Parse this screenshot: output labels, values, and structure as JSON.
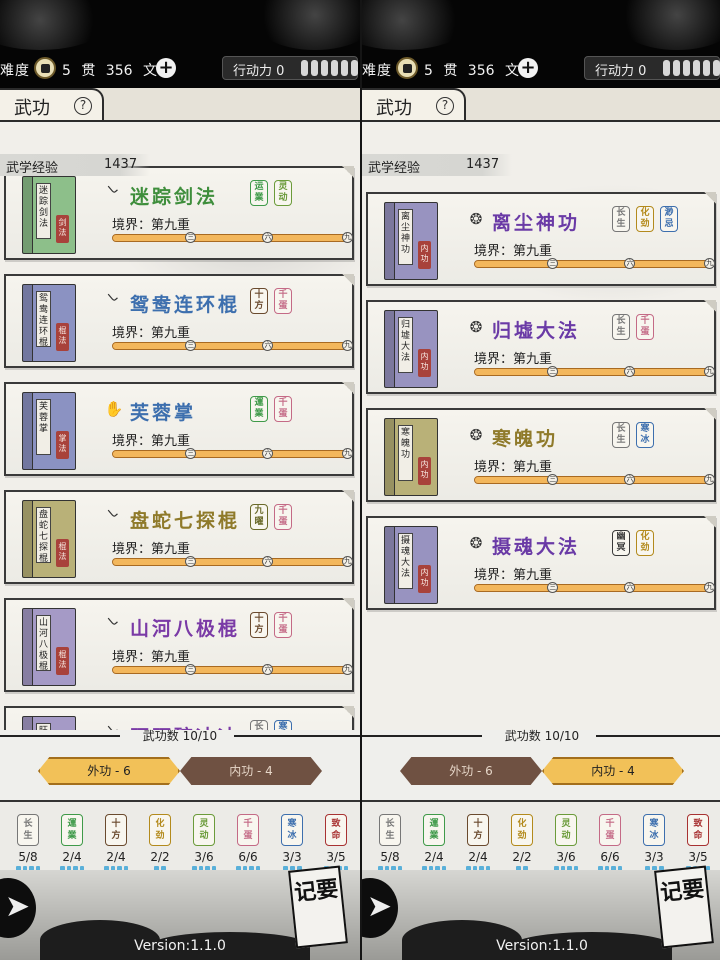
{
  "status": {
    "difficulty_label": "难度",
    "money": "5 贯 356 文",
    "action_label": "行动力",
    "action_value": "0"
  },
  "header": {
    "title": "武功",
    "help_symbol": "?"
  },
  "exp": {
    "label": "武学经验",
    "value": "1437"
  },
  "footer": {
    "count": "武功数 10/10",
    "tabs": {
      "outer": "外功 - 6",
      "inner": "内功 - 4"
    },
    "version": "Version:1.1.0",
    "memo": "记要"
  },
  "panels": {
    "left": {
      "active_tab": "outer",
      "skills": [
        {
          "name": "迷踪剑法",
          "book": "迷踪剑法",
          "seal": "剑法",
          "color": "#3f8e3c",
          "cover": "#8dbf8a",
          "icon": "sword-icon",
          "progress": 1.0,
          "badges": [
            {
              "t": "运\n業",
              "c": "#3f9a49"
            },
            {
              "t": "灵\n动",
              "c": "#6b9b3a"
            }
          ]
        },
        {
          "name": "鸳鸯连环棍",
          "book": "鸳鸯连环棍",
          "seal": "棍法",
          "color": "#3d6fae",
          "cover": "#8b92c2",
          "icon": "staff-icon",
          "progress": 1.0,
          "badges": [
            {
              "t": "十\n方",
              "c": "#6a4a2e"
            },
            {
              "t": "千\n蛋",
              "c": "#c46a86"
            }
          ]
        },
        {
          "name": "芙蓉掌",
          "book": "芙蓉掌",
          "seal": "掌法",
          "color": "#3d6fae",
          "cover": "#8b92c2",
          "icon": "palm-icon",
          "progress": 1.0,
          "badges": [
            {
              "t": "運\n業",
              "c": "#3f9a49"
            },
            {
              "t": "千\n蛋",
              "c": "#c46a86"
            }
          ]
        },
        {
          "name": "盘蛇七探棍",
          "book": "盘蛇七探棍",
          "seal": "棍法",
          "color": "#8f7a2a",
          "cover": "#b9b178",
          "icon": "staff-icon",
          "progress": 1.0,
          "badges": [
            {
              "t": "九\n曜",
              "c": "#6a6a2a"
            },
            {
              "t": "千\n蛋",
              "c": "#c46a86"
            }
          ]
        },
        {
          "name": "山河八极棍",
          "book": "山河八极棍",
          "seal": "棍法",
          "color": "#7a3aa6",
          "cover": "#a59ac6",
          "icon": "staff-icon",
          "progress": 1.0,
          "badges": [
            {
              "t": "十\n方",
              "c": "#6a4a2e"
            },
            {
              "t": "千\n蛋",
              "c": "#c46a86"
            }
          ]
        },
        {
          "name": "旺旺碎冰冰",
          "book": "旺旺",
          "seal": "",
          "color": "#7a3aa6",
          "cover": "#a59ac6",
          "icon": "staff-icon",
          "progress": 1.0,
          "badges": [
            {
              "t": "长\n生",
              "c": "#777"
            },
            {
              "t": "寒\n冰",
              "c": "#3d6fae"
            }
          ]
        }
      ]
    },
    "right": {
      "active_tab": "inner",
      "skills": [
        {
          "name": "离尘神功",
          "book": "离尘神功",
          "seal": "内功",
          "color": "#6a3aa6",
          "cover": "#9893c0",
          "icon": "spiral-icon",
          "progress": 1.0,
          "badges": [
            {
              "t": "长\n生",
              "c": "#777"
            },
            {
              "t": "化\n劲",
              "c": "#b38a1c"
            },
            {
              "t": "渺\n忌",
              "c": "#3d6fae"
            }
          ]
        },
        {
          "name": "归墟大法",
          "book": "归墟大法",
          "seal": "内功",
          "color": "#6a3aa6",
          "cover": "#9893c0",
          "icon": "spiral-icon",
          "progress": 1.0,
          "badges": [
            {
              "t": "长\n生",
              "c": "#777"
            },
            {
              "t": "千\n蛋",
              "c": "#c46a86"
            }
          ]
        },
        {
          "name": "寒魄功",
          "book": "寒魄功",
          "seal": "内功",
          "color": "#8f7a2a",
          "cover": "#b9b178",
          "icon": "spiral-icon",
          "progress": 1.0,
          "badges": [
            {
              "t": "长\n生",
              "c": "#777"
            },
            {
              "t": "寒\n冰",
              "c": "#3d6fae"
            }
          ]
        },
        {
          "name": "摄魂大法",
          "book": "摄魂大法",
          "seal": "内功",
          "color": "#6a3aa6",
          "cover": "#9893c0",
          "icon": "spiral-icon",
          "progress": 1.0,
          "badges": [
            {
              "t": "幽\n冥",
              "c": "#3a3a3a"
            },
            {
              "t": "化\n劲",
              "c": "#b38a1c"
            }
          ]
        }
      ]
    }
  },
  "realm_label": "境界：第九重",
  "bar_markers": [
    "三",
    "六",
    "九"
  ],
  "tags": [
    {
      "t": "长\n生",
      "c": "#777777",
      "count": "5/8"
    },
    {
      "t": "運\n業",
      "c": "#3f9a49",
      "count": "2/4"
    },
    {
      "t": "十\n方",
      "c": "#6a4a2e",
      "count": "2/4"
    },
    {
      "t": "化\n劲",
      "c": "#b38a1c",
      "count": "2/2"
    },
    {
      "t": "灵\n动",
      "c": "#6b9b3a",
      "count": "3/6"
    },
    {
      "t": "千\n蛋",
      "c": "#c46a86",
      "count": "6/6"
    },
    {
      "t": "寒\n冰",
      "c": "#3d6fae",
      "count": "3/3"
    },
    {
      "t": "致\n命",
      "c": "#a83232",
      "count": "3/5"
    }
  ]
}
